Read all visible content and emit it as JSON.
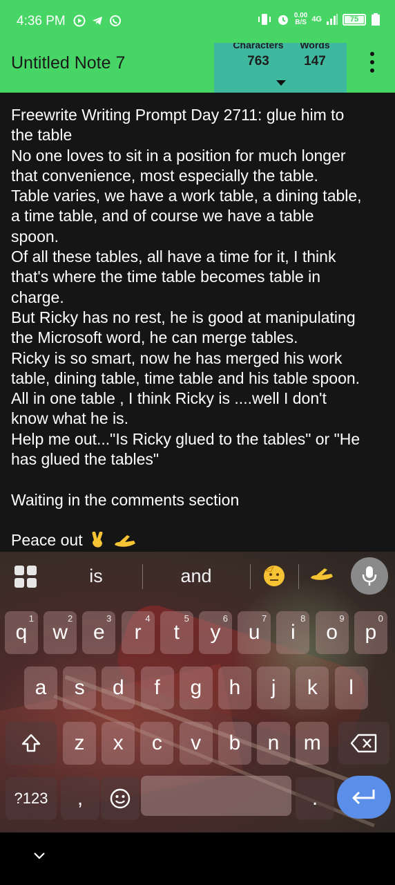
{
  "status_bar": {
    "time": "4:36 PM",
    "net_speed_value": "0.00",
    "net_speed_unit": "B/S",
    "network": "4G",
    "battery": "75"
  },
  "app_bar": {
    "title": "Untitled Note 7",
    "characters_label": "Characters",
    "characters_value": "763",
    "words_label": "Words",
    "words_value": "147"
  },
  "note": {
    "lines": [
      "Freewrite Writing Prompt Day 2711: glue him to",
      "the table",
      "No one loves to sit in a position for much longer",
      "that convenience, most especially the table.",
      "Table varies, we have a work table, a dining table,",
      "a time table, and of course we have a table",
      "spoon.",
      "Of all these tables, all have a time for it, I think",
      "that's where the time table becomes table in",
      "charge.",
      "But Ricky has no rest, he is good at manipulating",
      "the Microsoft word, he can merge tables.",
      "Ricky is so smart, now he has merged his work",
      "table, dining table, time table and his table spoon.",
      "All in one table , I think Ricky is ....well I don't",
      "know what he is.",
      "Help me out...\"Is Ricky glued to the tables\" or \"He",
      "has glued the tables\"",
      "",
      "Waiting in the comments section",
      "",
      "Peace out"
    ]
  },
  "keyboard": {
    "suggestions": [
      "is",
      "and"
    ],
    "row1": [
      {
        "k": "q",
        "h": "1"
      },
      {
        "k": "w",
        "h": "2"
      },
      {
        "k": "e",
        "h": "3"
      },
      {
        "k": "r",
        "h": "4"
      },
      {
        "k": "t",
        "h": "5"
      },
      {
        "k": "y",
        "h": "6"
      },
      {
        "k": "u",
        "h": "7"
      },
      {
        "k": "i",
        "h": "8"
      },
      {
        "k": "o",
        "h": "9"
      },
      {
        "k": "p",
        "h": "0"
      }
    ],
    "row2": [
      "a",
      "s",
      "d",
      "f",
      "g",
      "h",
      "j",
      "k",
      "l"
    ],
    "row3": [
      "z",
      "x",
      "c",
      "v",
      "b",
      "n",
      "m"
    ],
    "symbols_label": "?123",
    "comma": ",",
    "period": ".",
    "icons": [
      "grid-icon",
      "microphone-icon",
      "shift-icon",
      "backspace-icon",
      "emoji-icon",
      "enter-icon",
      "chevron-down-icon"
    ]
  }
}
